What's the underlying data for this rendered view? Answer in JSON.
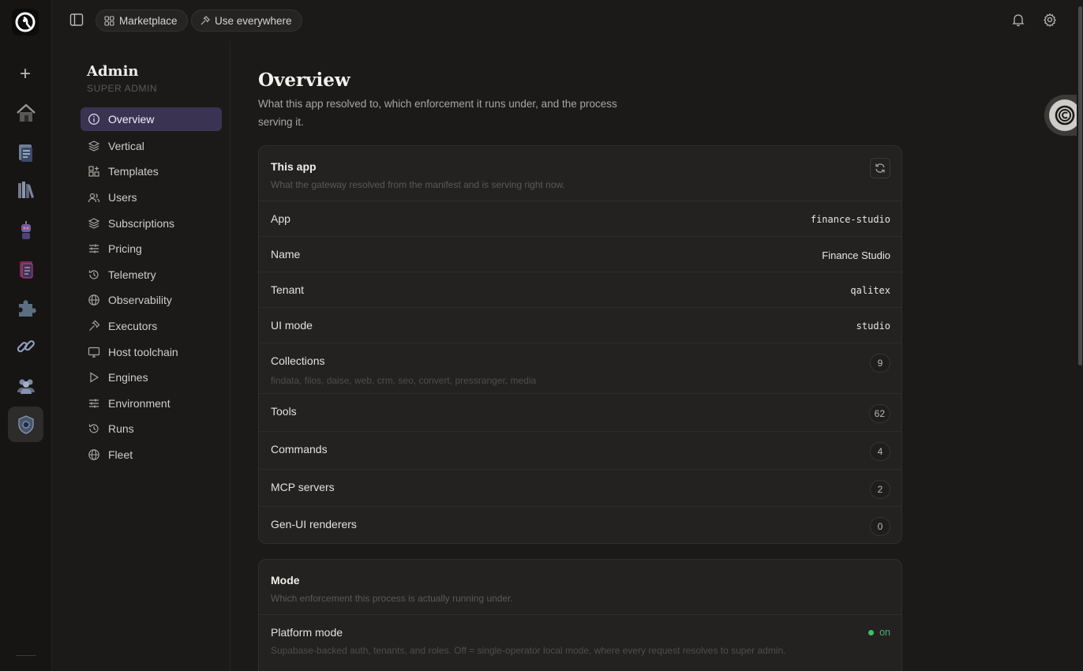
{
  "topbar": {
    "marketplace_label": "Marketplace",
    "use_everywhere_label": "Use everywhere"
  },
  "rail": {
    "items": [
      "home-icon",
      "documents-icon",
      "library-icon",
      "robot-icon",
      "report-icon",
      "puzzle-icon",
      "link-icon",
      "people-icon",
      "shield-icon"
    ],
    "active": "shield-icon"
  },
  "admin": {
    "title": "Admin",
    "role": "SUPER ADMIN",
    "nav": [
      {
        "label": "Overview",
        "icon": "info-icon"
      },
      {
        "label": "Vertical",
        "icon": "layers-icon"
      },
      {
        "label": "Templates",
        "icon": "grid-plus-icon"
      },
      {
        "label": "Users",
        "icon": "users-icon"
      },
      {
        "label": "Subscriptions",
        "icon": "layers-icon"
      },
      {
        "label": "Pricing",
        "icon": "sliders-icon"
      },
      {
        "label": "Telemetry",
        "icon": "history-icon"
      },
      {
        "label": "Observability",
        "icon": "globe-icon"
      },
      {
        "label": "Executors",
        "icon": "hammer-icon"
      },
      {
        "label": "Host toolchain",
        "icon": "monitor-icon"
      },
      {
        "label": "Engines",
        "icon": "play-icon"
      },
      {
        "label": "Environment",
        "icon": "sliders-icon"
      },
      {
        "label": "Runs",
        "icon": "history-icon"
      },
      {
        "label": "Fleet",
        "icon": "globe-icon"
      }
    ]
  },
  "main": {
    "title": "Overview",
    "description": "What this app resolved to, which enforcement it runs under, and the process serving it."
  },
  "this_app": {
    "title": "This app",
    "subtitle": "What the gateway resolved from the manifest and is serving right now.",
    "rows": {
      "app": {
        "label": "App",
        "value": "finance-studio"
      },
      "name": {
        "label": "Name",
        "value": "Finance Studio"
      },
      "tenant": {
        "label": "Tenant",
        "value": "qalitex"
      },
      "ui_mode": {
        "label": "UI mode",
        "value": "studio"
      },
      "collections": {
        "label": "Collections",
        "count": "9",
        "hint": "findata, filos, daise, web, crm, seo, convert, pressranger, media"
      },
      "tools": {
        "label": "Tools",
        "count": "62"
      },
      "commands": {
        "label": "Commands",
        "count": "4"
      },
      "mcp_servers": {
        "label": "MCP servers",
        "count": "2"
      },
      "genui": {
        "label": "Gen-UI renderers",
        "count": "0"
      }
    }
  },
  "mode": {
    "title": "Mode",
    "subtitle": "Which enforcement this process is actually running under.",
    "platform": {
      "label": "Platform mode",
      "hint": "Supabase-backed auth, tenants, and roles. Off = single-operator local mode, where every request resolves to super admin.",
      "status": "on",
      "status_color": "#3fbf6a"
    }
  }
}
